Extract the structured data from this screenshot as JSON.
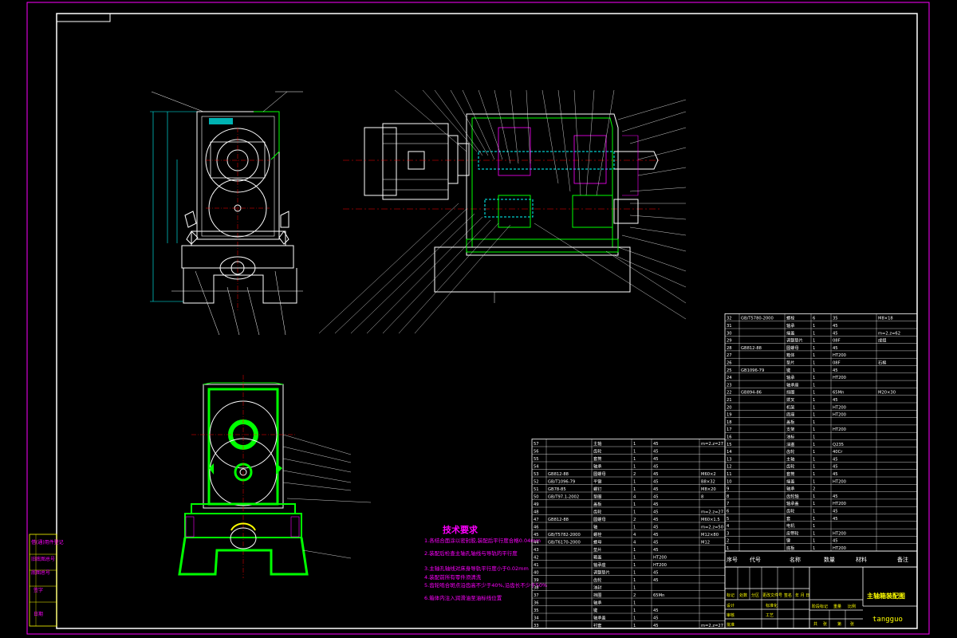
{
  "drawing": {
    "title_block": {
      "drawing_name": "主轴箱装配图",
      "author": "tangguo"
    },
    "tech_requirements": {
      "heading": "技术要求",
      "lines": [
        "1.各结合面涂以密封胶,装配后平行度合格0.04mm",
        "2.装配后检查主轴孔轴线与导轨的平行度",
        "3.主轴孔轴线对床身导轨平行度小于0.02mm",
        "4.装配前所有零件须清洗",
        "5.齿轮啮合斑点沿齿高不少于40%,沿齿长不少于50%",
        "6.箱体内注入润滑油至油标线位置"
      ]
    },
    "bom_headers": {
      "seq": "序号",
      "code": "代号",
      "name": "名称",
      "qty": "数量",
      "material": "材料",
      "remark": "备注"
    },
    "bom_right": [
      {
        "seq": "32",
        "code": "GB/T5780-2000",
        "name": "螺栓",
        "qty": "6",
        "material": "35",
        "remark": "M8×18"
      },
      {
        "seq": "31",
        "code": "",
        "name": "轴承",
        "qty": "1",
        "material": "45",
        "remark": ""
      },
      {
        "seq": "30",
        "code": "",
        "name": "端盖",
        "qty": "1",
        "material": "45",
        "remark": "m=2.z=62"
      },
      {
        "seq": "29",
        "code": "",
        "name": "调整垫片",
        "qty": "1",
        "material": "08F",
        "remark": "成组"
      },
      {
        "seq": "28",
        "code": "GB812-88",
        "name": "圆螺母",
        "qty": "1",
        "material": "45",
        "remark": ""
      },
      {
        "seq": "27",
        "code": "",
        "name": "箱体",
        "qty": "1",
        "material": "HT200",
        "remark": ""
      },
      {
        "seq": "26",
        "code": "",
        "name": "垫片",
        "qty": "1",
        "material": "08F",
        "remark": "石棉"
      },
      {
        "seq": "25",
        "code": "GB1096-79",
        "name": "键",
        "qty": "1",
        "material": "45",
        "remark": ""
      },
      {
        "seq": "24",
        "code": "",
        "name": "轴承",
        "qty": "1",
        "material": "HT200",
        "remark": ""
      },
      {
        "seq": "23",
        "code": "",
        "name": "轴承座",
        "qty": "1",
        "material": "",
        "remark": ""
      },
      {
        "seq": "22",
        "code": "GB894-86",
        "name": "挡圈",
        "qty": "1",
        "material": "65Mn",
        "remark": "M20×30"
      },
      {
        "seq": "21",
        "code": "",
        "name": "拨叉",
        "qty": "1",
        "material": "45",
        "remark": ""
      },
      {
        "seq": "20",
        "code": "",
        "name": "机架",
        "qty": "1",
        "material": "HT200",
        "remark": ""
      },
      {
        "seq": "19",
        "code": "",
        "name": "底座",
        "qty": "1",
        "material": "HT200",
        "remark": ""
      },
      {
        "seq": "18",
        "code": "",
        "name": "盖板",
        "qty": "1",
        "material": "",
        "remark": ""
      },
      {
        "seq": "17",
        "code": "",
        "name": "支架",
        "qty": "1",
        "material": "HT200",
        "remark": ""
      },
      {
        "seq": "16",
        "code": "",
        "name": "油标",
        "qty": "1",
        "material": "",
        "remark": ""
      },
      {
        "seq": "15",
        "code": "",
        "name": "油塞",
        "qty": "1",
        "material": "Q235",
        "remark": ""
      },
      {
        "seq": "14",
        "code": "",
        "name": "齿轮",
        "qty": "1",
        "material": "40Cr",
        "remark": ""
      },
      {
        "seq": "13",
        "code": "",
        "name": "主轴",
        "qty": "1",
        "material": "45",
        "remark": ""
      },
      {
        "seq": "12",
        "code": "",
        "name": "齿轮",
        "qty": "1",
        "material": "45",
        "remark": ""
      },
      {
        "seq": "11",
        "code": "",
        "name": "套筒",
        "qty": "1",
        "material": "45",
        "remark": ""
      },
      {
        "seq": "10",
        "code": "",
        "name": "端盖",
        "qty": "1",
        "material": "HT200",
        "remark": ""
      },
      {
        "seq": "9",
        "code": "",
        "name": "轴承",
        "qty": "2",
        "material": "",
        "remark": ""
      },
      {
        "seq": "8",
        "code": "",
        "name": "齿轮轴",
        "qty": "1",
        "material": "45",
        "remark": ""
      },
      {
        "seq": "7",
        "code": "",
        "name": "轴承盖",
        "qty": "1",
        "material": "HT200",
        "remark": ""
      },
      {
        "seq": "6",
        "code": "",
        "name": "齿轮",
        "qty": "1",
        "material": "45",
        "remark": ""
      },
      {
        "seq": "5",
        "code": "",
        "name": "套",
        "qty": "1",
        "material": "45",
        "remark": ""
      },
      {
        "seq": "4",
        "code": "",
        "name": "电机",
        "qty": "1",
        "material": "",
        "remark": ""
      },
      {
        "seq": "3",
        "code": "",
        "name": "皮带轮",
        "qty": "1",
        "material": "HT200",
        "remark": ""
      },
      {
        "seq": "2",
        "code": "",
        "name": "键",
        "qty": "1",
        "material": "45",
        "remark": ""
      },
      {
        "seq": "1",
        "code": "",
        "name": "底板",
        "qty": "1",
        "material": "HT200",
        "remark": ""
      }
    ],
    "bom_left": [
      {
        "seq": "57",
        "code": "",
        "name": "主轴",
        "qty": "1",
        "material": "45",
        "remark": "m=2.z=27"
      },
      {
        "seq": "56",
        "code": "",
        "name": "齿轮",
        "qty": "1",
        "material": "45",
        "remark": ""
      },
      {
        "seq": "55",
        "code": "",
        "name": "套筒",
        "qty": "1",
        "material": "45",
        "remark": ""
      },
      {
        "seq": "54",
        "code": "",
        "name": "轴承",
        "qty": "1",
        "material": "45",
        "remark": ""
      },
      {
        "seq": "53",
        "code": "GB812-88",
        "name": "圆螺母",
        "qty": "2",
        "material": "45",
        "remark": "M60×2"
      },
      {
        "seq": "52",
        "code": "GB/T1096-79",
        "name": "平键",
        "qty": "1",
        "material": "45",
        "remark": "B8×32"
      },
      {
        "seq": "51",
        "code": "GB78-85",
        "name": "螺钉",
        "qty": "1",
        "material": "45",
        "remark": "M8×20"
      },
      {
        "seq": "50",
        "code": "GB/T97.1-2002",
        "name": "垫圈",
        "qty": "4",
        "material": "45",
        "remark": "8"
      },
      {
        "seq": "49",
        "code": "",
        "name": "盖板",
        "qty": "1",
        "material": "45",
        "remark": ""
      },
      {
        "seq": "48",
        "code": "",
        "name": "齿轮",
        "qty": "1",
        "material": "45",
        "remark": "m=2.z=27"
      },
      {
        "seq": "47",
        "code": "GB812-88",
        "name": "圆螺母",
        "qty": "2",
        "material": "45",
        "remark": "M60×1.5"
      },
      {
        "seq": "46",
        "code": "",
        "name": "轴",
        "qty": "1",
        "material": "45",
        "remark": "m=2.z=50"
      },
      {
        "seq": "45",
        "code": "GB/T5782-2000",
        "name": "螺栓",
        "qty": "4",
        "material": "45",
        "remark": "M12×80"
      },
      {
        "seq": "44",
        "code": "GB/T6170-2000",
        "name": "螺母",
        "qty": "4",
        "material": "45",
        "remark": "M12"
      },
      {
        "seq": "43",
        "code": "",
        "name": "垫片",
        "qty": "1",
        "material": "45",
        "remark": ""
      },
      {
        "seq": "42",
        "code": "",
        "name": "箱盖",
        "qty": "1",
        "material": "HT200",
        "remark": ""
      },
      {
        "seq": "41",
        "code": "",
        "name": "轴承座",
        "qty": "1",
        "material": "HT200",
        "remark": ""
      },
      {
        "seq": "40",
        "code": "",
        "name": "调整垫片",
        "qty": "1",
        "material": "45",
        "remark": ""
      },
      {
        "seq": "39",
        "code": "",
        "name": "齿轮",
        "qty": "1",
        "material": "45",
        "remark": ""
      },
      {
        "seq": "38",
        "code": "",
        "name": "油封",
        "qty": "1",
        "material": "",
        "remark": ""
      },
      {
        "seq": "37",
        "code": "",
        "name": "挡圈",
        "qty": "2",
        "material": "65Mn",
        "remark": ""
      },
      {
        "seq": "36",
        "code": "",
        "name": "轴承",
        "qty": "1",
        "material": "",
        "remark": ""
      },
      {
        "seq": "35",
        "code": "",
        "name": "键",
        "qty": "1",
        "material": "45",
        "remark": ""
      },
      {
        "seq": "34",
        "code": "",
        "name": "轴承盖",
        "qty": "1",
        "material": "45",
        "remark": ""
      },
      {
        "seq": "33",
        "code": "",
        "name": "衬套",
        "qty": "1",
        "material": "45",
        "remark": "m=2.z=27"
      }
    ],
    "side_strip": [
      "借(通)用件登记",
      "旧底图总号",
      "底图总号",
      "签字",
      "日期"
    ],
    "title_block_fields": {
      "row1": [
        "标记",
        "处数",
        "分区",
        "更改文件号",
        "签名",
        "年 月 日"
      ],
      "row2": [
        "设计",
        "",
        "标准化",
        ""
      ],
      "row3": [
        "审核",
        "",
        "工艺",
        "",
        "批准"
      ],
      "stage": [
        "阶段标记",
        "重量",
        "比例"
      ],
      "sheet": [
        "共",
        "张",
        "第",
        "张"
      ]
    },
    "colors": {
      "border": "#ff00ff",
      "line": "#ffffff",
      "green": "#00ff00",
      "cyan": "#00ffff",
      "magenta": "#ff00ff",
      "blue": "#4040ff",
      "yellow": "#ffff00",
      "red": "#ff0000"
    }
  }
}
